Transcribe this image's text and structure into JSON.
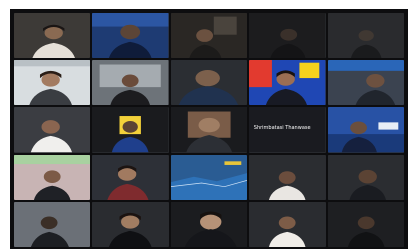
{
  "meeting": {
    "participants": [
      {
        "name": "",
        "bg": "#3d3a37"
      },
      {
        "name": "",
        "bg": "#1e3b73"
      },
      {
        "name": "",
        "bg": "#2a2724"
      },
      {
        "name": "",
        "bg": "#1c1c1e"
      },
      {
        "name": "",
        "bg": "#2a2b2e"
      },
      {
        "name": "",
        "bg": "#d8dde0"
      },
      {
        "name": "",
        "bg": "#6d7379"
      },
      {
        "name": "",
        "bg": "#2b2e33"
      },
      {
        "name": "",
        "bg": "#1f47b4"
      },
      {
        "name": "",
        "bg": "#3b4350"
      },
      {
        "name": "",
        "bg": "#3b3d42"
      },
      {
        "name": "",
        "bg": "#1a1b1e"
      },
      {
        "name": "",
        "bg": "#1a1b1e"
      },
      {
        "name": "",
        "bg": "#1a1b20",
        "overlay": "Shrimbatasi Thanwase"
      },
      {
        "name": "",
        "bg": "#2852a5"
      },
      {
        "name": "",
        "bg": "#c8b4b4"
      },
      {
        "name": "",
        "bg": "#2d3037"
      },
      {
        "name": "",
        "bg": "#2a5c93"
      },
      {
        "name": "",
        "bg": "#2b2d31"
      },
      {
        "name": "",
        "bg": "#2b2d31"
      },
      {
        "name": "",
        "bg": "#6b7077"
      },
      {
        "name": "",
        "bg": "#2a2c30"
      },
      {
        "name": "",
        "bg": "#1b1c1f"
      },
      {
        "name": "",
        "bg": "#2a2c30"
      },
      {
        "name": "",
        "bg": "#1e1f22"
      }
    ]
  }
}
